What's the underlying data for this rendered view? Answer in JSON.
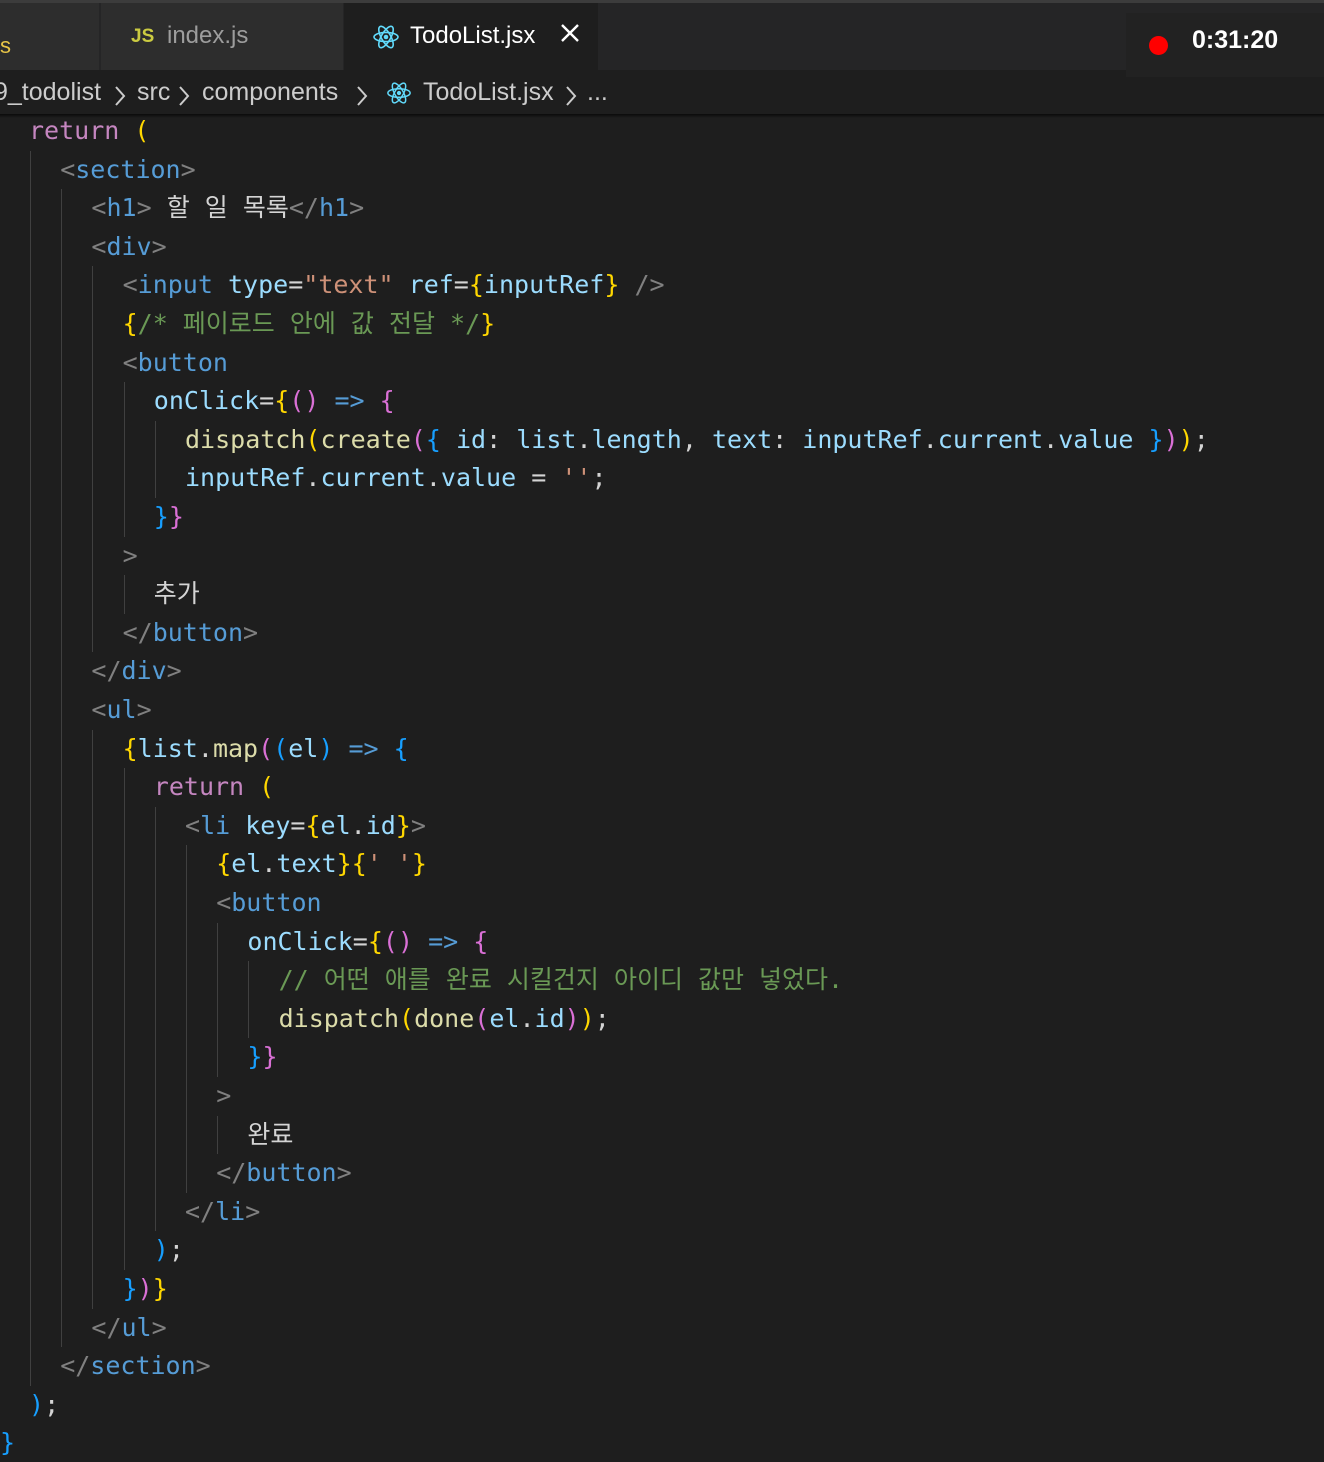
{
  "tabs": [
    {
      "label": "",
      "icon": "js-icon",
      "partial_glyph": "s"
    },
    {
      "label": "index.js",
      "icon": "js-icon",
      "icon_text": "JS"
    },
    {
      "label": "TodoList.jsx",
      "icon": "react-icon",
      "active": true
    }
  ],
  "recording": {
    "time": "0:31:20",
    "color": "#ff0000"
  },
  "breadcrumb": {
    "items": [
      "9_todolist",
      "src",
      "components",
      "TodoList.jsx",
      "..."
    ],
    "separator": ">"
  },
  "code_lines": [
    "return (",
    "<section>",
    "<h1> 할 일 목록</h1>",
    "<div>",
    "<input type=\"text\" ref={inputRef} />",
    "{/* 페이로드 안에 값 전달 */}",
    "<button",
    "onClick={() => {",
    "dispatch(create({ id: list.length, text: inputRef.current.value }));",
    "inputRef.current.value = '';",
    "}}",
    ">",
    "추가",
    "</button>",
    "</div>",
    "<ul>",
    "{list.map((el) => {",
    "return (",
    "<li key={el.id}>",
    "{el.text}{' '}",
    "<button",
    "onClick={() => {",
    "// 어떤 애를 완료 시킬건지 아이디 값만 넣었다.",
    "dispatch(done(el.id));",
    "}}",
    ">",
    "완료",
    "</button>",
    "</li>",
    ");",
    "})}",
    "</ul>",
    "</section>",
    ");",
    "}"
  ],
  "colors": {
    "background": "#1e1e1e",
    "keyword": "#c586c0",
    "tag": "#569cd6",
    "attribute": "#9cdcfe",
    "string": "#ce9178",
    "function": "#dcdcaa",
    "comment": "#6a9955"
  }
}
